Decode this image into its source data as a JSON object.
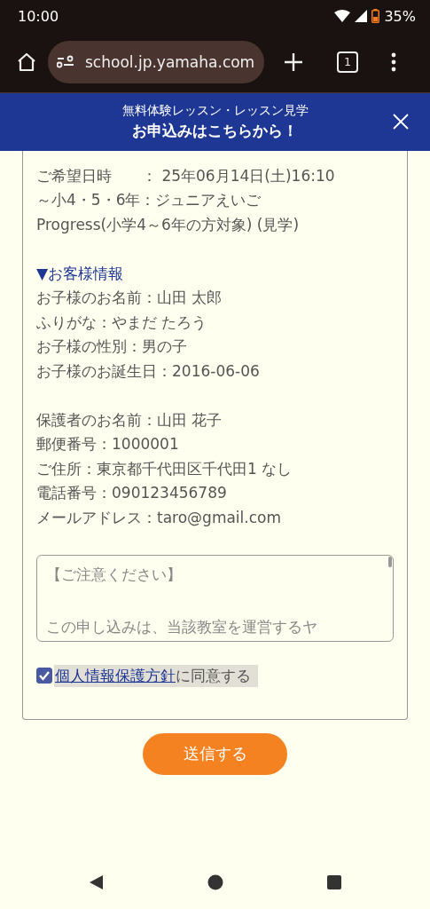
{
  "status_bar": {
    "time": "10:00",
    "battery": "35%"
  },
  "browser": {
    "url": "school.jp.yamaha.com",
    "tab_count": "1"
  },
  "banner": {
    "subtitle": "無料体験レッスン・レッスン見学",
    "title": "お申込みはこちらから！"
  },
  "summary": [
    {
      "lines": [
        "ご希望日時　　：  25年06月14日(土)16:10",
        "～小4・5・6年：ジュニアえいご",
        "Progress(小学4～6年の方対象) (見学)"
      ]
    },
    {
      "heading": "▼お客様情報",
      "lines": [
        "お子様のお名前：山田 太郎",
        "ふりがな：やまだ たろう",
        "お子様の性別：男の子",
        "お子様のお誕生日：2016-06-06"
      ]
    },
    {
      "lines": [
        "保護者のお名前：山田 花子",
        "郵便番号：1000001",
        "ご住所：東京都千代田区千代田1 なし",
        "電話番号：090123456789",
        "メールアドレス：taro@gmail.com"
      ]
    }
  ],
  "notice": {
    "lines": [
      "【ご注意ください】",
      "この申し込みは、当該教室を運営するヤ"
    ]
  },
  "consent": {
    "checked": true,
    "link": "個人情報保護方針",
    "text": "に同意する"
  },
  "submit": "送信する"
}
